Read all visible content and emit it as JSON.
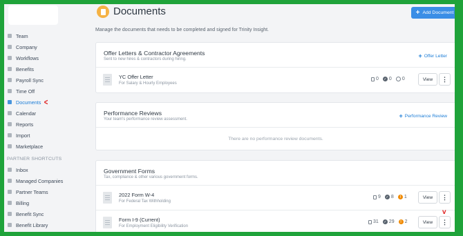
{
  "sidebar": {
    "items": [
      {
        "label": "Team"
      },
      {
        "label": "Company"
      },
      {
        "label": "Workflows"
      },
      {
        "label": "Benefits"
      },
      {
        "label": "Payroll Sync"
      },
      {
        "label": "Time Off"
      },
      {
        "label": "Documents",
        "active": true
      },
      {
        "label": "Calendar"
      },
      {
        "label": "Reports"
      },
      {
        "label": "Import"
      },
      {
        "label": "Marketplace"
      }
    ],
    "section_label": "PARTNER SHORTCUTS",
    "shortcuts": [
      {
        "label": "Inbox"
      },
      {
        "label": "Managed Companies"
      },
      {
        "label": "Partner Teams"
      },
      {
        "label": "Billing"
      },
      {
        "label": "Benefit Sync"
      },
      {
        "label": "Benefit Library"
      }
    ]
  },
  "header": {
    "title": "Documents",
    "add_button": "Add Document",
    "subtitle": "Manage the documents that needs to be completed and signed for Trinity Insight."
  },
  "sections": [
    {
      "title": "Offer Letters & Contractor Agreements",
      "description": "Sent to new hires & contractors during hiring.",
      "link": "Offer Letter",
      "docs": [
        {
          "name": "YC Offer Letter",
          "sub": "For Salary & Hourly Employees",
          "count_docs": "0",
          "count_done": "0",
          "count_pending": "0",
          "view": "View"
        }
      ]
    },
    {
      "title": "Performance Reviews",
      "description": "Your team's performance review assessment.",
      "link": "Performance Review",
      "empty": "There are no performance review documents."
    },
    {
      "title": "Government Forms",
      "description": "Tax, compliance & other various government forms.",
      "docs": [
        {
          "name": "2022 Form W-4",
          "sub": "For Federal Tax Withholding",
          "count_docs": "9",
          "count_done": "8",
          "count_warn": "1",
          "view": "View"
        },
        {
          "name": "Form I-9 (Current)",
          "sub": "For Employment Eligibility Verification",
          "count_docs": "31",
          "count_done": "29",
          "count_warn": "2",
          "view": "View"
        }
      ]
    }
  ],
  "colors": {
    "accent": "#1b7cd6",
    "button_blue": "#3b8ee6",
    "warning": "#f08a00",
    "page_icon": "#f5b244",
    "annotation_red": "#e02020",
    "frame_green": "#1fa33a"
  }
}
